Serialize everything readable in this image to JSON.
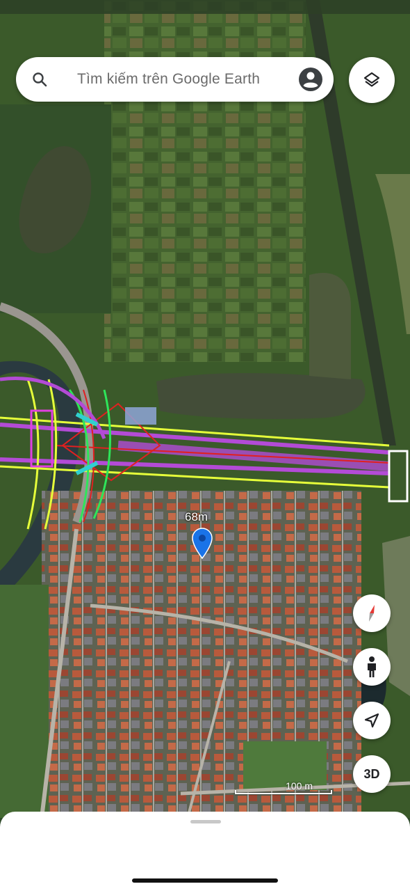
{
  "search": {
    "placeholder": "Tìm kiếm trên Google Earth"
  },
  "map": {
    "distance_label": "68m",
    "scale_label": "100 m"
  },
  "controls": {
    "btn_3d_label": "3D"
  },
  "colors": {
    "pin": "#1a73e8",
    "compass_red": "#e53935",
    "road_overlay_magenta": "#b34bd6",
    "road_overlay_yellow": "#e6ff3a",
    "road_overlay_red": "#e02020",
    "road_overlay_green": "#2ee65a"
  },
  "icons": {
    "search": "search-icon",
    "account": "account-circle-icon",
    "layers": "layers-icon",
    "compass": "compass-icon",
    "street_view": "person-icon",
    "my_location": "navigation-arrow-icon"
  }
}
